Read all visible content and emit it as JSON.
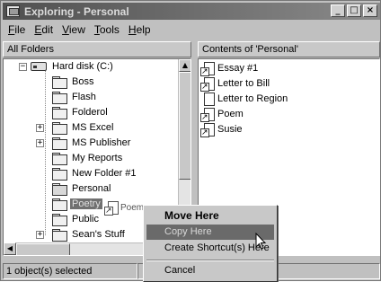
{
  "window": {
    "title": "Exploring - Personal",
    "minimize": "_",
    "maximize": "□",
    "close": "×"
  },
  "menu": [
    "File",
    "Edit",
    "View",
    "Tools",
    "Help"
  ],
  "left_pane": {
    "header": "All Folders",
    "drive": {
      "label": "Hard disk (C:)",
      "expander": "−"
    },
    "folders": [
      {
        "label": "Boss",
        "expander": ""
      },
      {
        "label": "Flash",
        "expander": ""
      },
      {
        "label": "Folderol",
        "expander": ""
      },
      {
        "label": "MS Excel",
        "expander": "+"
      },
      {
        "label": "MS Publisher",
        "expander": "+"
      },
      {
        "label": "My Reports",
        "expander": ""
      },
      {
        "label": "New Folder #1",
        "expander": ""
      },
      {
        "label": "Personal",
        "expander": ""
      },
      {
        "label": "Poetry",
        "expander": ""
      },
      {
        "label": "Public",
        "expander": ""
      },
      {
        "label": "Sean's Stuff",
        "expander": "+"
      }
    ],
    "drag_ghost_label": "Poem"
  },
  "right_pane": {
    "header": "Contents of 'Personal'",
    "files": [
      {
        "label": "Essay #1",
        "icon": "document-shortcut-icon"
      },
      {
        "label": "Letter to Bill",
        "icon": "document-shortcut-icon"
      },
      {
        "label": "Letter to Region",
        "icon": "document-icon"
      },
      {
        "label": "Poem",
        "icon": "document-shortcut-icon"
      },
      {
        "label": "Susie",
        "icon": "document-shortcut-icon"
      }
    ]
  },
  "status": {
    "selection": "1 object(s) selected"
  },
  "context_menu": {
    "items": [
      {
        "label": "Move Here",
        "bold": true
      },
      {
        "label": "Copy Here",
        "highlighted": true
      },
      {
        "label": "Create Shortcut(s) Here"
      },
      {
        "label": "Cancel"
      }
    ]
  }
}
